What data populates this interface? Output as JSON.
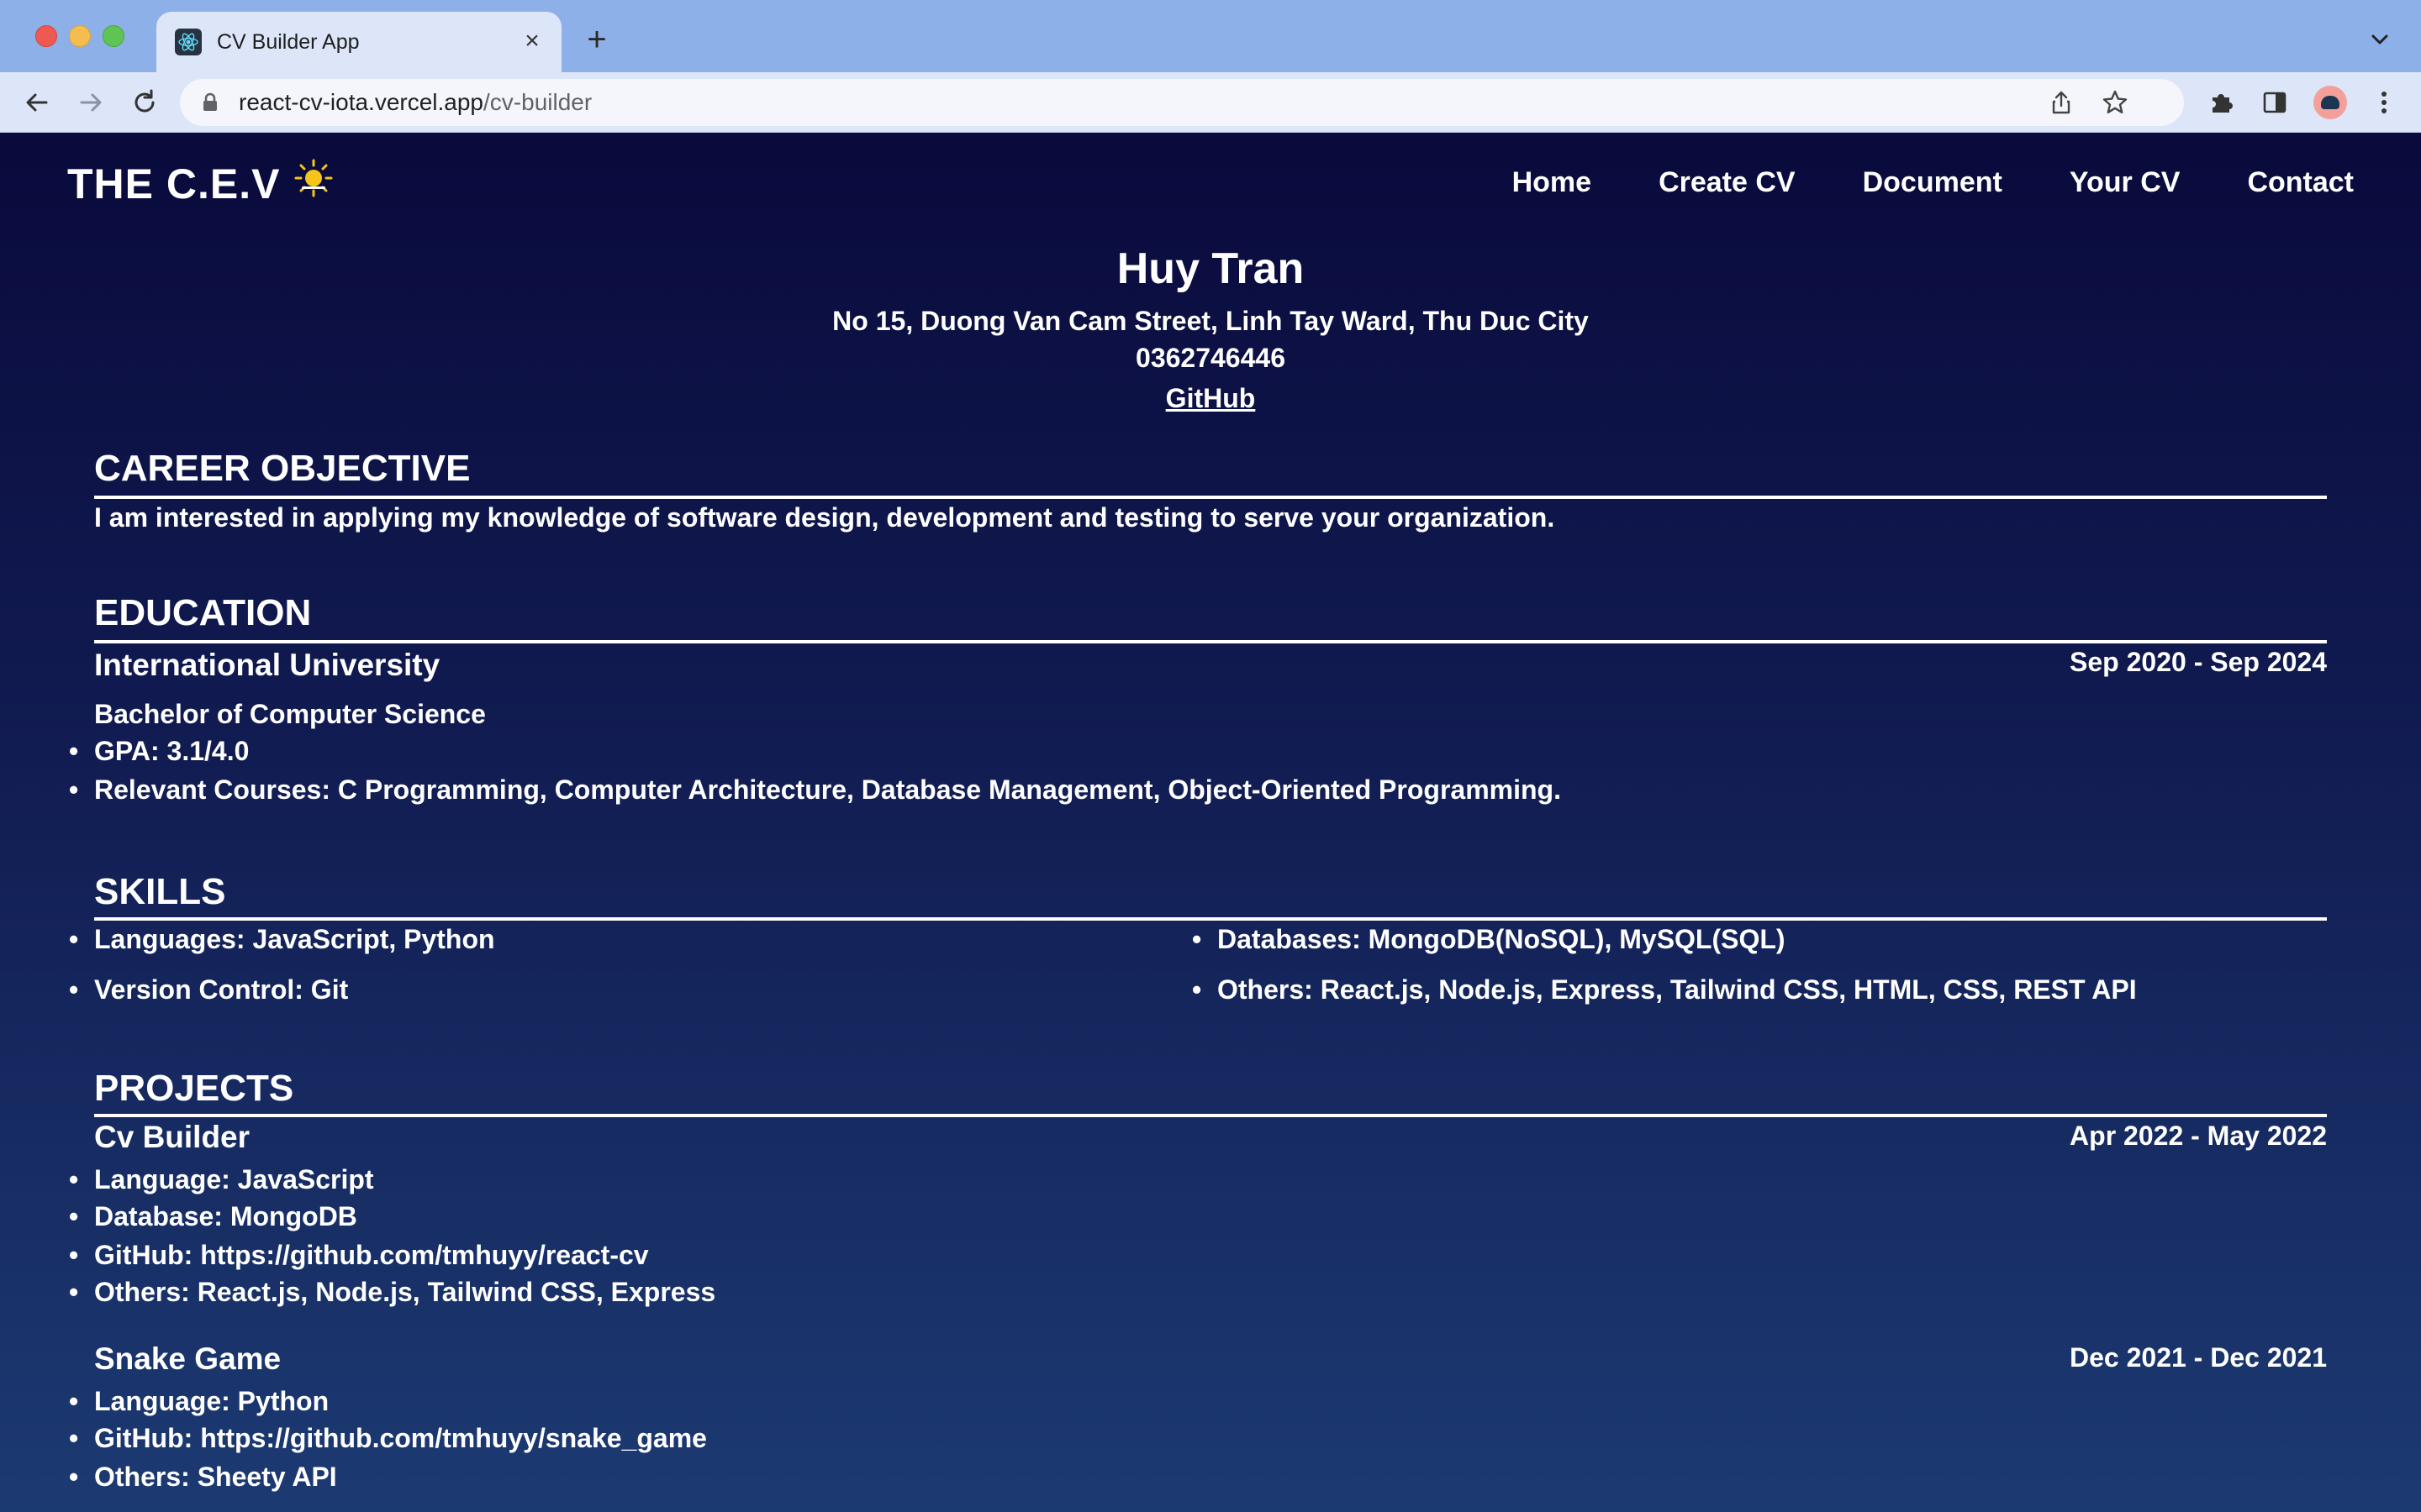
{
  "browser": {
    "tab_title": "CV Builder App",
    "tab_close": "×",
    "new_tab": "+",
    "url_host": "react-cv-iota.vercel.app",
    "url_path": "/cv-builder"
  },
  "site": {
    "brand": "THE C.E.V",
    "nav": [
      "Home",
      "Create CV",
      "Document",
      "Your CV",
      "Contact"
    ]
  },
  "cv": {
    "name": "Huy Tran",
    "address": "No 15, Duong Van Cam Street, Linh Tay Ward, Thu Duc City",
    "phone": "0362746446",
    "github_link": "GitHub",
    "career": {
      "title": "CAREER OBJECTIVE",
      "text": "I am interested in applying my knowledge of software design, development and testing to serve your organization."
    },
    "education": {
      "title": "EDUCATION",
      "school": "International University",
      "dates": "Sep 2020 - Sep 2024",
      "degree": "Bachelor of Computer Science",
      "bullets": [
        "GPA: 3.1/4.0",
        "Relevant Courses: C Programming, Computer Architecture, Database Management, Object-Oriented Programming."
      ]
    },
    "skills": {
      "title": "SKILLS",
      "left": [
        "Languages: JavaScript, Python",
        "Version Control: Git"
      ],
      "right": [
        "Databases: MongoDB(NoSQL), MySQL(SQL)",
        "Others: React.js, Node.js, Express, Tailwind CSS, HTML, CSS, REST API"
      ]
    },
    "projects": {
      "title": "PROJECTS",
      "items": [
        {
          "name": "Cv Builder",
          "dates": "Apr 2022 - May 2022",
          "bullets": [
            "Language: JavaScript",
            "Database: MongoDB",
            "GitHub: https://github.com/tmhuyy/react-cv",
            "Others: React.js, Node.js, Tailwind CSS, Express"
          ]
        },
        {
          "name": "Snake Game",
          "dates": "Dec 2021 - Dec 2021",
          "bullets": [
            "Language: Python",
            "GitHub: https://github.com/tmhuyy/snake_game",
            "Others: Sheety API"
          ]
        }
      ]
    }
  },
  "colors": {
    "page_top": "#0a0a3c",
    "page_bottom": "#1c3a72",
    "chrome": "#8eb0e8",
    "sun": "#f5c518"
  },
  "icons": [
    "react-favicon-icon",
    "back-arrow-icon",
    "forward-arrow-icon",
    "reload-icon",
    "lock-icon",
    "share-icon",
    "star-icon",
    "extensions-icon",
    "sidebar-icon",
    "more-icon",
    "sun-icon",
    "chevron-down-icon"
  ]
}
